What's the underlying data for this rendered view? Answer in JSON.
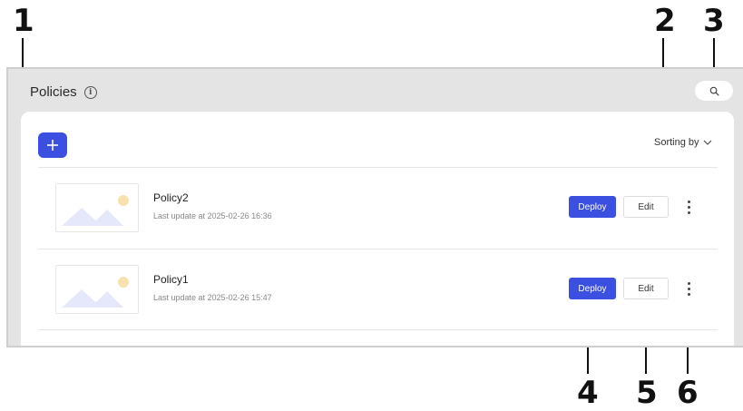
{
  "callouts": [
    "1",
    "2",
    "3",
    "4",
    "5",
    "6"
  ],
  "header": {
    "title": "Policies",
    "info_icon": "info-icon"
  },
  "toolbar": {
    "add_icon": "plus-icon",
    "sorting_label": "Sorting by",
    "search_icon": "search-icon"
  },
  "policies": [
    {
      "name": "Policy2",
      "last_update": "Last update at 2025-02-26 16:36",
      "deploy_label": "Deploy",
      "edit_label": "Edit"
    },
    {
      "name": "Policy1",
      "last_update": "Last update at 2025-02-26 15:47",
      "deploy_label": "Deploy",
      "edit_label": "Edit"
    }
  ],
  "colors": {
    "accent": "#3b4fe0",
    "background": "#e4e4e4",
    "thumb_shape": "#e5e8fb",
    "thumb_sun": "#f7e2ae"
  }
}
